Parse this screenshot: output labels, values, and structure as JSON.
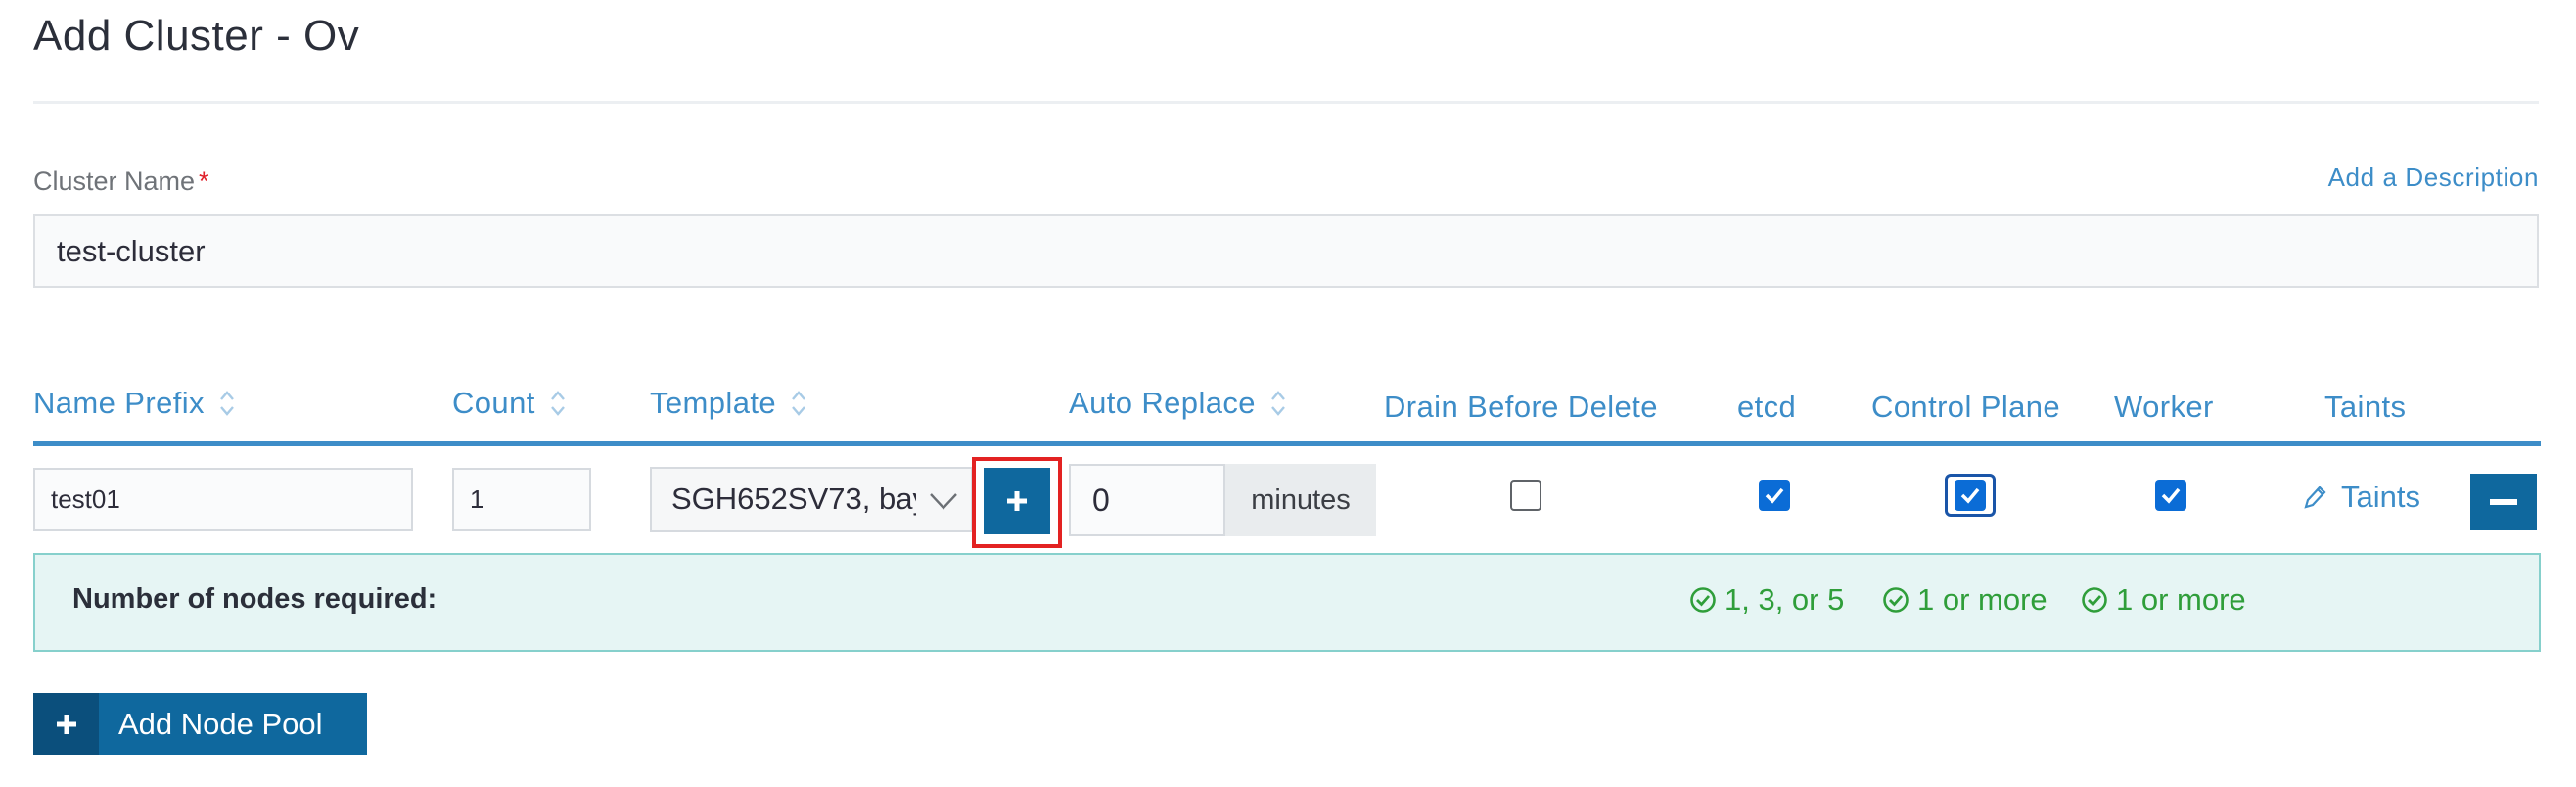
{
  "page": {
    "title": "Add Cluster - Ov"
  },
  "cluster_name": {
    "label": "Cluster Name",
    "required_mark": "*",
    "value": "test-cluster",
    "add_description_link": "Add a Description"
  },
  "table": {
    "headers": {
      "name_prefix": "Name Prefix",
      "count": "Count",
      "template": "Template",
      "auto_replace": "Auto Replace",
      "drain_before_delete": "Drain Before Delete",
      "etcd": "etcd",
      "control_plane": "Control Plane",
      "worker": "Worker",
      "taints": "Taints"
    },
    "rows": [
      {
        "name_prefix": "test01",
        "count": "1",
        "template": "SGH652SV73, bay",
        "auto_replace_value": "0",
        "auto_replace_unit": "minutes",
        "drain_before_delete": false,
        "etcd": true,
        "control_plane": true,
        "worker": true,
        "taints_label": "Taints"
      }
    ]
  },
  "nodes_required": {
    "label": "Number of nodes required:",
    "etcd": "1, 3, or 5",
    "control_plane": "1 or more",
    "worker": "1 or more"
  },
  "add_node_pool": {
    "label": "Add Node Pool"
  },
  "colors": {
    "accent": "#3d8dc8",
    "primary_button": "#0f689e",
    "success": "#2f9e3a",
    "highlight": "#e32222"
  }
}
